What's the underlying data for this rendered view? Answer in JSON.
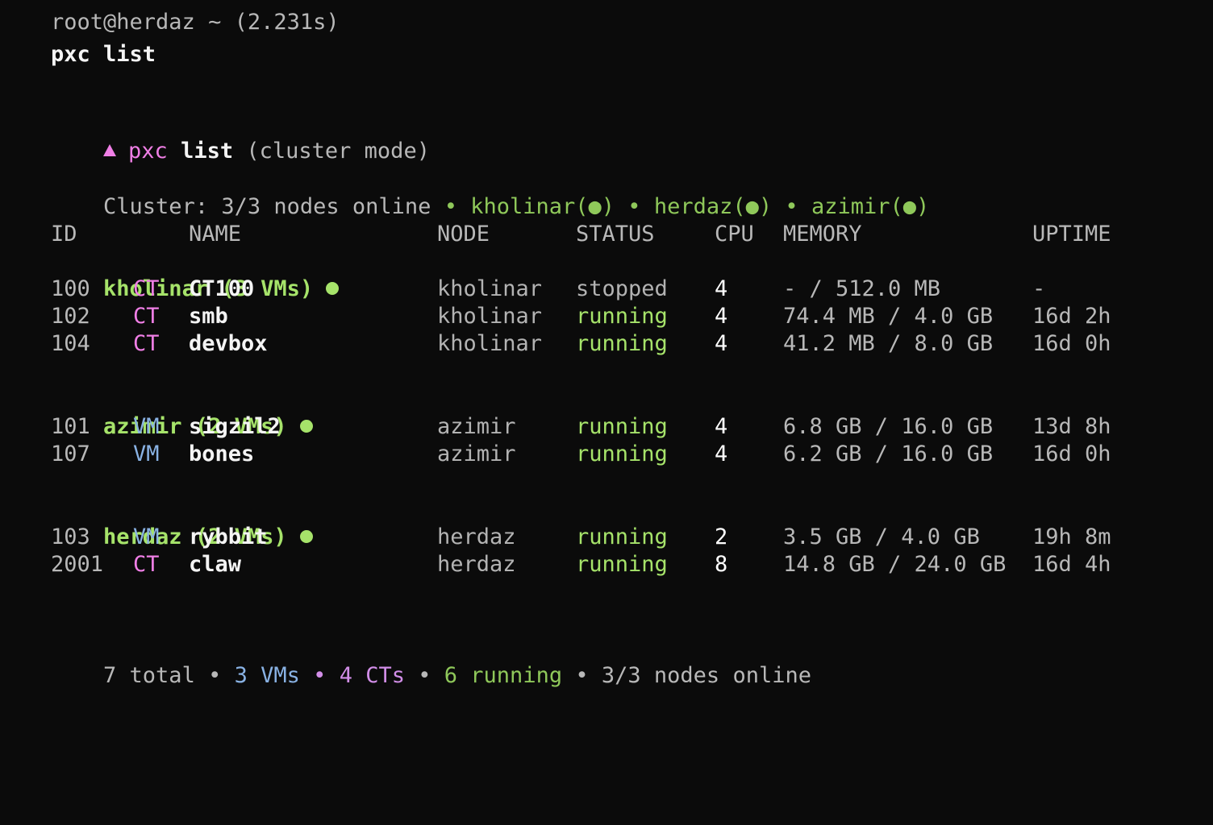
{
  "prompt": {
    "host": "root@herdaz ~ (2.231s)",
    "command": "pxc list"
  },
  "header": {
    "app": "pxc",
    "command": "list",
    "mode": "(cluster mode)",
    "accent_color": "#f07fe6"
  },
  "cluster": {
    "label": "Cluster: 3/3 nodes online",
    "separator": "•",
    "nodes": [
      "kholinar(●)",
      "herdaz(●)",
      "azimir(●)"
    ],
    "online_color": "#a6e36a"
  },
  "table": {
    "columns": [
      "ID",
      "NAME",
      "NODE",
      "STATUS",
      "CPU",
      "MEMORY",
      "UPTIME"
    ],
    "groups": [
      {
        "title": "kholinar (3 VMs)",
        "rows": [
          {
            "id": "100",
            "type": "CT",
            "name": "CT100",
            "node": "kholinar",
            "status": "stopped",
            "cpu": "4",
            "memory": "- / 512.0 MB",
            "uptime": "-"
          },
          {
            "id": "102",
            "type": "CT",
            "name": "smb",
            "node": "kholinar",
            "status": "running",
            "cpu": "4",
            "memory": "74.4 MB / 4.0 GB",
            "uptime": "16d 2h"
          },
          {
            "id": "104",
            "type": "CT",
            "name": "devbox",
            "node": "kholinar",
            "status": "running",
            "cpu": "4",
            "memory": "41.2 MB / 8.0 GB",
            "uptime": "16d 0h"
          }
        ]
      },
      {
        "title": "azimir (2 VMs)",
        "rows": [
          {
            "id": "101",
            "type": "VM",
            "name": "sigzil2",
            "node": "azimir",
            "status": "running",
            "cpu": "4",
            "memory": "6.8 GB / 16.0 GB",
            "uptime": "13d 8h"
          },
          {
            "id": "107",
            "type": "VM",
            "name": "bones",
            "node": "azimir",
            "status": "running",
            "cpu": "4",
            "memory": "6.2 GB / 16.0 GB",
            "uptime": "16d 0h"
          }
        ]
      },
      {
        "title": "herdaz (2 VMs)",
        "rows": [
          {
            "id": "103",
            "type": "VM",
            "name": "rybbit",
            "node": "herdaz",
            "status": "running",
            "cpu": "2",
            "memory": "3.5 GB / 4.0 GB",
            "uptime": "19h 8m"
          },
          {
            "id": "2001",
            "type": "CT",
            "name": "claw",
            "node": "herdaz",
            "status": "running",
            "cpu": "8",
            "memory": "14.8 GB / 24.0 GB",
            "uptime": "16d 4h"
          }
        ]
      }
    ]
  },
  "summary": {
    "total": "7 total",
    "vms": "3 VMs",
    "cts": "4 CTs",
    "running": "6 running",
    "nodes": "3/3 nodes online",
    "separator": "•"
  },
  "colors": {
    "background": "#0b0b0b",
    "running": "#a6e36a",
    "stopped": "#b3b3b3",
    "ct": "#f07fe6",
    "vm": "#89b2e4"
  }
}
